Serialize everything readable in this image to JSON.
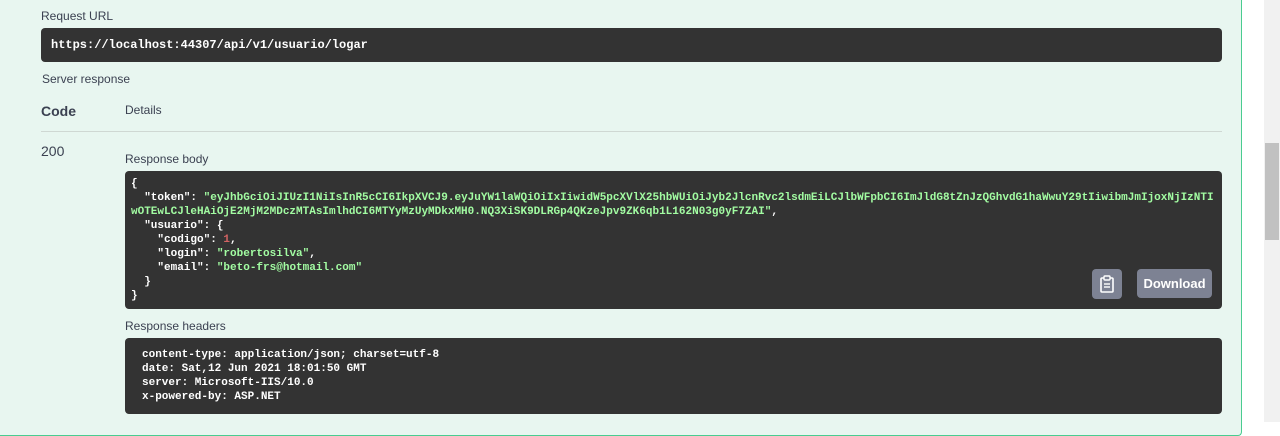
{
  "request_url": {
    "label": "Request URL",
    "value": "https://localhost:44307/api/v1/usuario/logar"
  },
  "server_response": {
    "label": "Server response",
    "columns": {
      "code": "Code",
      "details": "Details"
    },
    "code": "200",
    "response_body": {
      "label": "Response body",
      "lines": {
        "open": "{",
        "token_key": "\"token\": ",
        "token_value": "\"eyJhbGciOiJIUzI1NiIsInR5cCI6IkpXVCJ9.eyJuYW1laWQiOiIxIiwidW5pcXVlX25hbWUiOiJyb2JlcnRvc2lsdmEiLCJlbWFpbCI6ImJldG8tZnJzQGhvdG1haWwuY29tIiwibmJmIjoxNjIzNTIwOTEwLCJleHAiOjE2MjM2MDczMTAsImlhdCI6MTYyMzUyMDkxMH0.NQ3XiSK9DLRGp4QKzeJpv9ZK6qb1L162N03g0yF7ZAI\"",
        "token_comma": ",",
        "usuario_key": "  \"usuario\": {",
        "codigo_key": "    \"codigo\": ",
        "codigo_value": "1",
        "codigo_comma": ",",
        "login_key": "    \"login\": ",
        "login_value": "\"robertosilva\"",
        "login_comma": ",",
        "email_key": "    \"email\": ",
        "email_value": "\"beto-frs@hotmail.com\"",
        "usuario_close": "  }",
        "close": "}"
      },
      "copy_icon": "clipboard-icon",
      "download_label": "Download"
    },
    "response_headers": {
      "label": "Response headers",
      "lines": [
        "content-type: application/json; charset=utf-8",
        "date: Sat,12 Jun 2021 18:01:50 GMT",
        "server: Microsoft-IIS/10.0",
        "x-powered-by: ASP.NET"
      ]
    }
  },
  "colors": {
    "panel_bg": "#e8f6f0",
    "panel_border": "#49cc90",
    "code_bg": "#333333",
    "string": "#a2fca2",
    "number": "#d36363",
    "button_bg": "#7d8293"
  }
}
